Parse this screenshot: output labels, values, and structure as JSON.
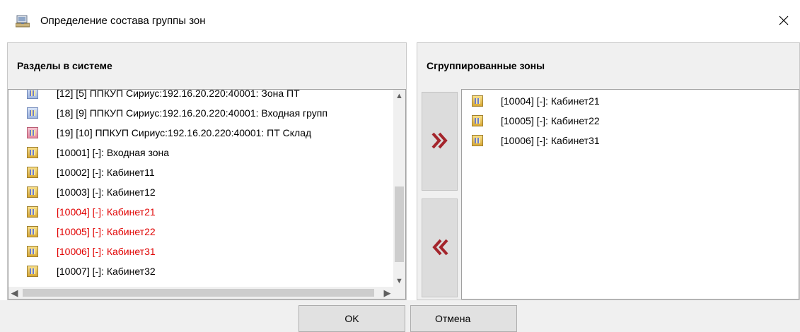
{
  "window": {
    "title": "Определение состава группы зон",
    "title_icon": "zone-group-icon",
    "close_label": "✕"
  },
  "left_panel": {
    "header": "Разделы в системе",
    "items": [
      {
        "label": "[12] [5] ППКУП Сириус:192.16.20.220:40001: Зона ПТ",
        "icon": "zone-icon-blue",
        "selected": false
      },
      {
        "label": "[18] [9] ППКУП Сириус:192.16.20.220:40001: Входная групп",
        "icon": "zone-icon-blue",
        "selected": false
      },
      {
        "label": "[19] [10] ППКУП Сириус:192.16.20.220:40001: ПТ Склад",
        "icon": "zone-icon-red",
        "selected": false
      },
      {
        "label": "[10001] [-]: Входная зона",
        "icon": "zone-icon",
        "selected": false
      },
      {
        "label": "[10002] [-]: Кабинет11",
        "icon": "zone-icon",
        "selected": false
      },
      {
        "label": "[10003] [-]: Кабинет12",
        "icon": "zone-icon",
        "selected": false
      },
      {
        "label": "[10004] [-]: Кабинет21",
        "icon": "zone-icon",
        "selected": true
      },
      {
        "label": "[10005] [-]: Кабинет22",
        "icon": "zone-icon",
        "selected": true
      },
      {
        "label": "[10006] [-]: Кабинет31",
        "icon": "zone-icon",
        "selected": true
      },
      {
        "label": "[10007] [-]: Кабинет32",
        "icon": "zone-icon",
        "selected": false
      }
    ]
  },
  "move_buttons": {
    "add_icon": "double-chevron-right-icon",
    "remove_icon": "double-chevron-left-icon",
    "color": "#a4252c"
  },
  "right_panel": {
    "header": "Сгруппированные зоны",
    "items": [
      {
        "label": "[10004] [-]: Кабинет21",
        "icon": "zone-icon"
      },
      {
        "label": "[10005] [-]: Кабинет22",
        "icon": "zone-icon"
      },
      {
        "label": "[10006] [-]: Кабинет31",
        "icon": "zone-icon"
      }
    ]
  },
  "buttons": {
    "ok": "OK",
    "cancel": "Отмена"
  },
  "colors": {
    "selected_text": "#e00000",
    "panel_background": "#f0f0f0"
  }
}
